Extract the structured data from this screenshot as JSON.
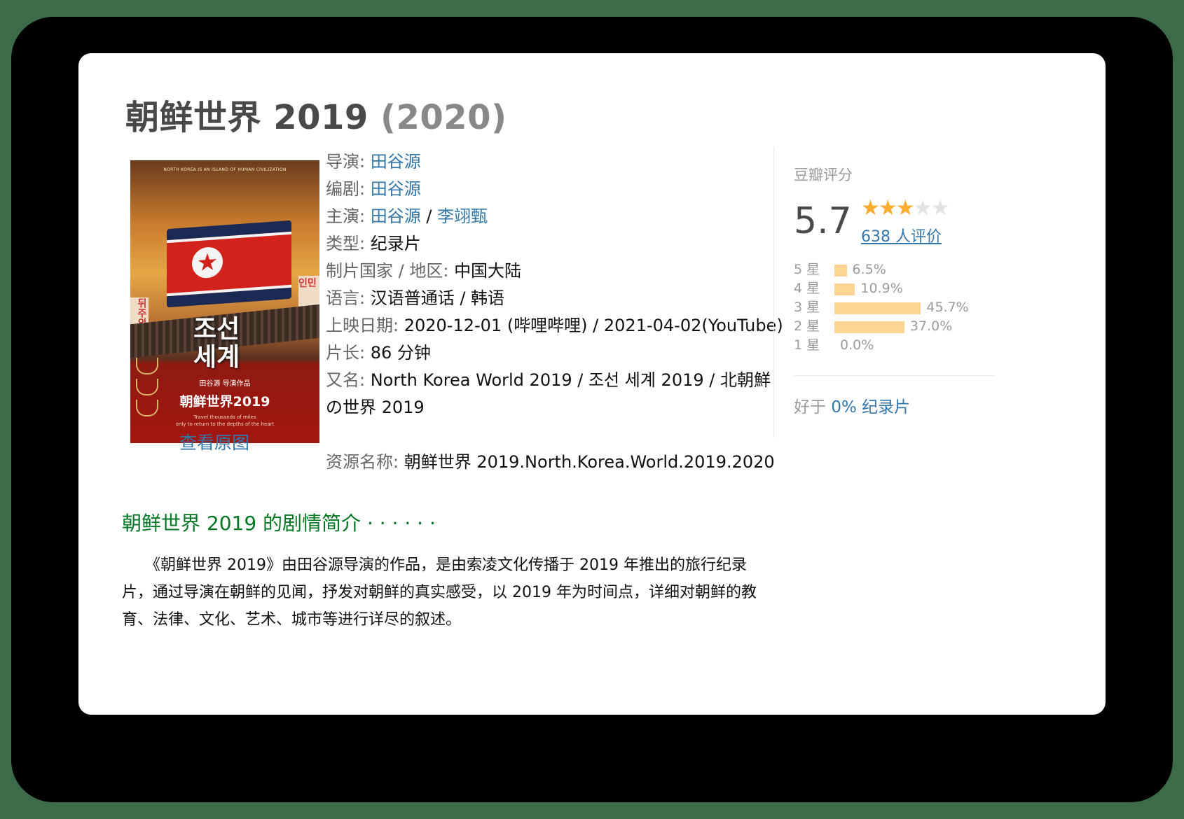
{
  "movie": {
    "title": "朝鲜世界 2019",
    "year": "(2020)",
    "view_original": "查看原图"
  },
  "poster": {
    "top_line": "NORTH KOREA IS AN ISLAND OF HUMAN CIVILIZATION",
    "korean_title_1": "조선",
    "korean_title_2": "세계",
    "sign_left": "뒤주의",
    "sign_right": "인민",
    "director_credit": "田谷源 导演作品",
    "cn_title": "朝鲜世界2019",
    "tagline": "Travel thousands of miles\nonly to return to the depths of the heart"
  },
  "info": {
    "director_label": "导演",
    "director": "田谷源",
    "writer_label": "编剧",
    "writer": "田谷源",
    "cast_label": "主演",
    "cast": [
      "田谷源",
      "李翊甄"
    ],
    "genre_label": "类型",
    "genre": "纪录片",
    "country_label": "制片国家 / 地区",
    "country": "中国大陆",
    "language_label": "语言",
    "language": "汉语普通话 / 韩语",
    "release_label": "上映日期",
    "release": "2020-12-01 (哔哩哔哩) / 2021-04-02(YouTube)",
    "runtime_label": "片长",
    "runtime": "86 分钟",
    "aka_label": "又名",
    "aka": "North Korea World 2019 / 조선 세계 2019 / 北朝鮮の世界 2019",
    "resource_label": "资源名称",
    "resource": "朝鲜世界 2019.North.Korea.World.2019.2020"
  },
  "rating": {
    "header": "豆瓣评分",
    "score": "5.7",
    "stars": 3,
    "max_stars": 5,
    "count_text": "638 人评价",
    "distribution": [
      {
        "label": "5 星",
        "percent": 6.5,
        "text": "6.5%"
      },
      {
        "label": "4 星",
        "percent": 10.9,
        "text": "10.9%"
      },
      {
        "label": "3 星",
        "percent": 45.7,
        "text": "45.7%"
      },
      {
        "label": "2 星",
        "percent": 37.0,
        "text": "37.0%"
      },
      {
        "label": "1 星",
        "percent": 0.0,
        "text": "0.0%"
      }
    ],
    "better_than_prefix": "好于 ",
    "better_than_link": "0% 纪录片",
    "bar_color": "#ffd596",
    "star_color": "#ffac2d"
  },
  "intro": {
    "title": "朝鲜世界 2019 的剧情简介 · · · · · ·",
    "body": "　　《朝鲜世界 2019》由田谷源导演的作品，是由索凌文化传播于 2019 年推出的旅行纪录片，通过导演在朝鲜的见闻，抒发对朝鲜的真实感受，以 2019 年为时间点，详细对朝鲜的教育、法律、文化、艺术、城市等进行详尽的叙述。"
  },
  "colors": {
    "link": "#3377aa",
    "section_title": "#007722",
    "background": "#3d6a48"
  }
}
